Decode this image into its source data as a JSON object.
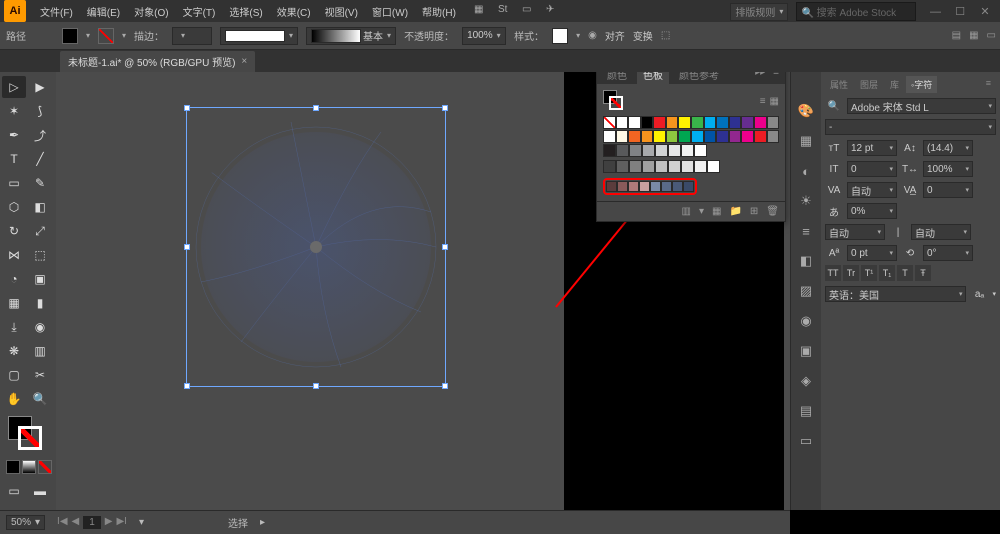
{
  "app": {
    "logo": "Ai"
  },
  "menu": {
    "items": [
      "文件(F)",
      "编辑(E)",
      "对象(O)",
      "文字(T)",
      "选择(S)",
      "效果(C)",
      "视图(V)",
      "窗口(W)",
      "帮助(H)"
    ]
  },
  "top_right": {
    "workspace": "排版规则",
    "search_placeholder": "搜索 Adobe Stock"
  },
  "control": {
    "label": "路径",
    "stroke_label": "描边：",
    "stroke_value": "",
    "style_dd": "基本",
    "opacity_label": "不透明度：",
    "opacity_value": "100%",
    "style2_label": "样式：",
    "doc_setup": "对齐",
    "transform": "变换"
  },
  "document": {
    "tab_title": "未标题-1.ai* @ 50% (RGB/GPU 预览)"
  },
  "swatches_panel": {
    "tabs": [
      "颜色",
      "色板",
      "颜色参考"
    ],
    "active_tab": 1,
    "colors_row1": [
      "#ffffff",
      "#000000",
      "#ed1c24",
      "#f7941d",
      "#fff200",
      "#39b54a",
      "#00aeef",
      "#0072bc",
      "#2e3192",
      "#662d91",
      "#ec008c",
      "#898989"
    ],
    "colors_row2": [
      "#ffffff",
      "#fff9e6",
      "#f26522",
      "#f7941d",
      "#fff200",
      "#8dc63f",
      "#00a651",
      "#00aeef",
      "#0054a6",
      "#2e3192",
      "#92278f",
      "#ec008c",
      "#ed1c24",
      "#898989"
    ],
    "colors_row3": [
      "#231f20",
      "#58595b",
      "#808285",
      "#a7a9ac",
      "#d1d3d4",
      "#e6e7e8",
      "#f1f2f2",
      "#ffffff"
    ],
    "grays": [
      "#404040",
      "#606060",
      "#808080",
      "#a0a0a0",
      "#c0c0c0",
      "#d0d0d0",
      "#e0e0e0",
      "#f0f0f0",
      "#ffffff"
    ],
    "highlighted_row": [
      "#5b3c3c",
      "#8a5a5a",
      "#b07a7a",
      "#c9a0a0",
      "#7a8aa8",
      "#5a6a88",
      "#4a5a78",
      "#3a4a68"
    ]
  },
  "character": {
    "tabs": [
      "属性",
      "图层",
      "库",
      "◦字符"
    ],
    "active_tab": 3,
    "font_family": "Adobe 宋体 Std L",
    "font_style": "-",
    "size_label": "12 pt",
    "leading_label": "(14.4)",
    "kerning": "0",
    "tracking": "100%",
    "va1": "自动",
    "va2": "0",
    "scale_h": "0%",
    "scale_auto1": "自动",
    "scale_auto2": "自动",
    "baseline": "0 pt",
    "rotation": "0°",
    "btn_tt": "TT",
    "btn_tr": "Tr",
    "btn_t1": "T¹",
    "btn_t2": "T₁",
    "btn_t": "T",
    "btn_ts": "Ŧ",
    "language": "英语：美国",
    "aa": "aₐ"
  },
  "status": {
    "zoom": "50%",
    "page": "1",
    "tool": "选择"
  }
}
